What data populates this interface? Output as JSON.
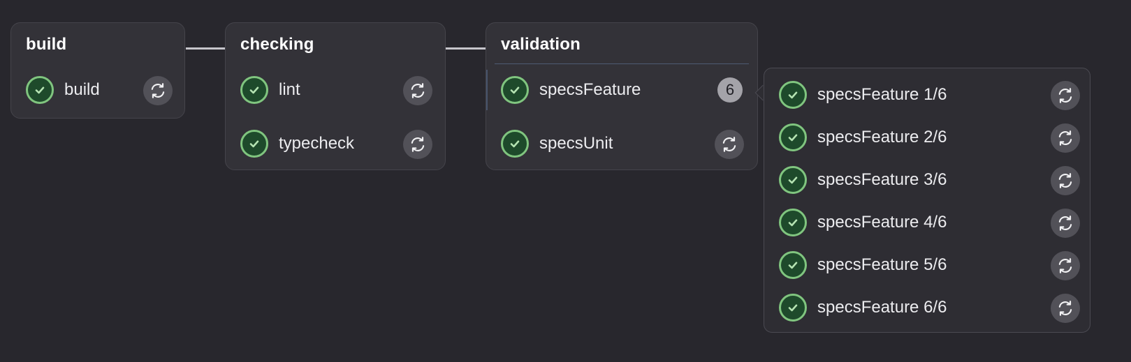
{
  "stages": [
    {
      "title": "build",
      "jobs": [
        {
          "name": "build",
          "status_icon": "check-circle-icon",
          "action_icon": "retry-icon"
        }
      ]
    },
    {
      "title": "checking",
      "jobs": [
        {
          "name": "lint",
          "status_icon": "check-circle-icon",
          "action_icon": "retry-icon"
        },
        {
          "name": "typecheck",
          "status_icon": "check-circle-icon",
          "action_icon": "retry-icon"
        }
      ]
    },
    {
      "title": "validation",
      "jobs": [
        {
          "name": "specsFeature",
          "status_icon": "check-circle-icon",
          "count": "6"
        },
        {
          "name": "specsUnit",
          "status_icon": "check-circle-icon",
          "action_icon": "retry-icon"
        }
      ]
    }
  ],
  "dropdown": {
    "items": [
      {
        "name": "specsFeature 1/6"
      },
      {
        "name": "specsFeature 2/6"
      },
      {
        "name": "specsFeature 3/6"
      },
      {
        "name": "specsFeature 4/6"
      },
      {
        "name": "specsFeature 5/6"
      },
      {
        "name": "specsFeature 6/6"
      }
    ]
  },
  "colors": {
    "background": "#28272d",
    "card": "#333238",
    "success_ring": "#80c57f",
    "success_fill": "#1e4a2b",
    "retry_button": "#525158",
    "badge": "#a4a3a9"
  }
}
